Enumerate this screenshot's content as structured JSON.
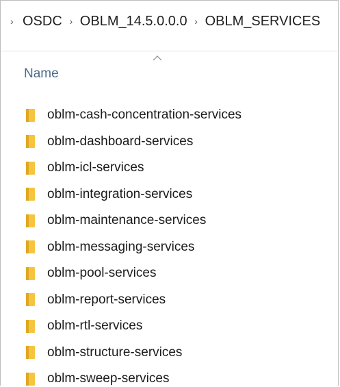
{
  "breadcrumb": {
    "items": [
      "OSDC",
      "OBLM_14.5.0.0.0",
      "OBLM_SERVICES"
    ]
  },
  "list": {
    "column_header": "Name",
    "items": [
      "oblm-cash-concentration-services",
      "oblm-dashboard-services",
      "oblm-icl-services",
      "oblm-integration-services",
      "oblm-maintenance-services",
      "oblm-messaging-services",
      "oblm-pool-services",
      "oblm-report-services",
      "oblm-rtl-services",
      "oblm-structure-services",
      "oblm-sweep-services"
    ]
  },
  "colors": {
    "folder_fill": "#f5c542",
    "folder_shade": "#e0a820",
    "header_text": "#4a6b8a",
    "divider": "#e3e3e3"
  },
  "icons": {
    "breadcrumb_separator": "chevron-right-icon",
    "sort": "sort-ascending-icon",
    "item": "folder-icon"
  }
}
